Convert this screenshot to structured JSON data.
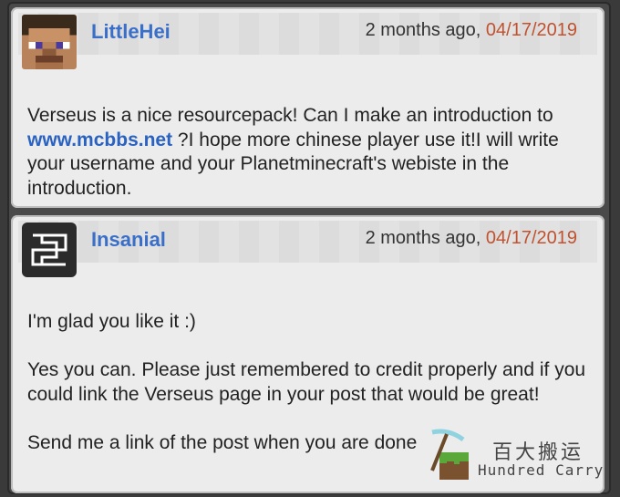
{
  "comments": [
    {
      "username": "LittleHei",
      "time_ago": "2 months ago,",
      "date": "04/17/2019",
      "avatar_icon": "steve-avatar-icon",
      "body_before_link": "Verseus is a nice resourcepack! Can I make an introduction to ",
      "link": "www.mcbbs.net",
      "body_after_link": " ?I hope more chinese player use it!I will write your username and your Planetminecraft's webiste in the introduction."
    },
    {
      "username": "Insanial",
      "time_ago": "2 months ago,",
      "date": "04/17/2019",
      "avatar_icon": "insanial-logo-avatar-icon",
      "paragraphs": [
        "I'm glad you like it :)",
        "Yes you can. Please just remembered to credit properly and if you could link the Verseus page in your post that would be great!",
        "Send me a link of the post when you are done"
      ]
    }
  ],
  "watermark": {
    "chinese": "百大搬运",
    "english": "Hundred Carry",
    "icon": "pickaxe-grass-block-icon"
  },
  "colors": {
    "username": "#3a6fc9",
    "date": "#c0522f",
    "link": "#2a62c2"
  }
}
